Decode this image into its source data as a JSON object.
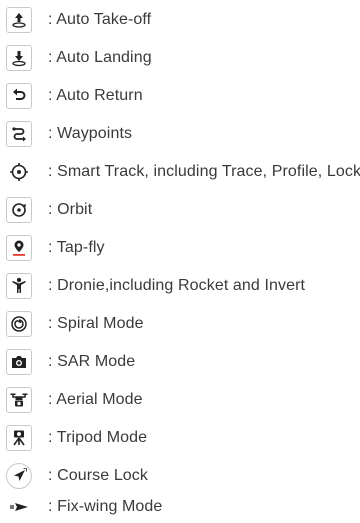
{
  "legend": {
    "items": [
      {
        "icon": "auto-takeoff-icon",
        "label": ": Auto Take-off"
      },
      {
        "icon": "auto-landing-icon",
        "label": ": Auto Landing"
      },
      {
        "icon": "auto-return-icon",
        "label": ": Auto Return"
      },
      {
        "icon": "waypoints-icon",
        "label": ": Waypoints"
      },
      {
        "icon": "smart-track-icon",
        "label": ": Smart Track, including Trace, Profile, Lock"
      },
      {
        "icon": "orbit-icon",
        "label": ": Orbit"
      },
      {
        "icon": "tap-fly-icon",
        "label": ": Tap-fly"
      },
      {
        "icon": "dronie-icon",
        "label": ": Dronie,including Rocket and Invert"
      },
      {
        "icon": "spiral-mode-icon",
        "label": ": Spiral Mode"
      },
      {
        "icon": "sar-mode-icon",
        "label": ": SAR Mode"
      },
      {
        "icon": "aerial-mode-icon",
        "label": ": Aerial Mode"
      },
      {
        "icon": "tripod-mode-icon",
        "label": ": Tripod Mode"
      },
      {
        "icon": "course-lock-icon",
        "label": ": Course Lock"
      },
      {
        "icon": "fix-wing-mode-icon",
        "label": ": Fix-wing Mode"
      }
    ],
    "colors": {
      "icon": "#222222",
      "text": "#3a3a3a",
      "border": "#c9c9c9",
      "accent": "#e23b2e"
    }
  }
}
